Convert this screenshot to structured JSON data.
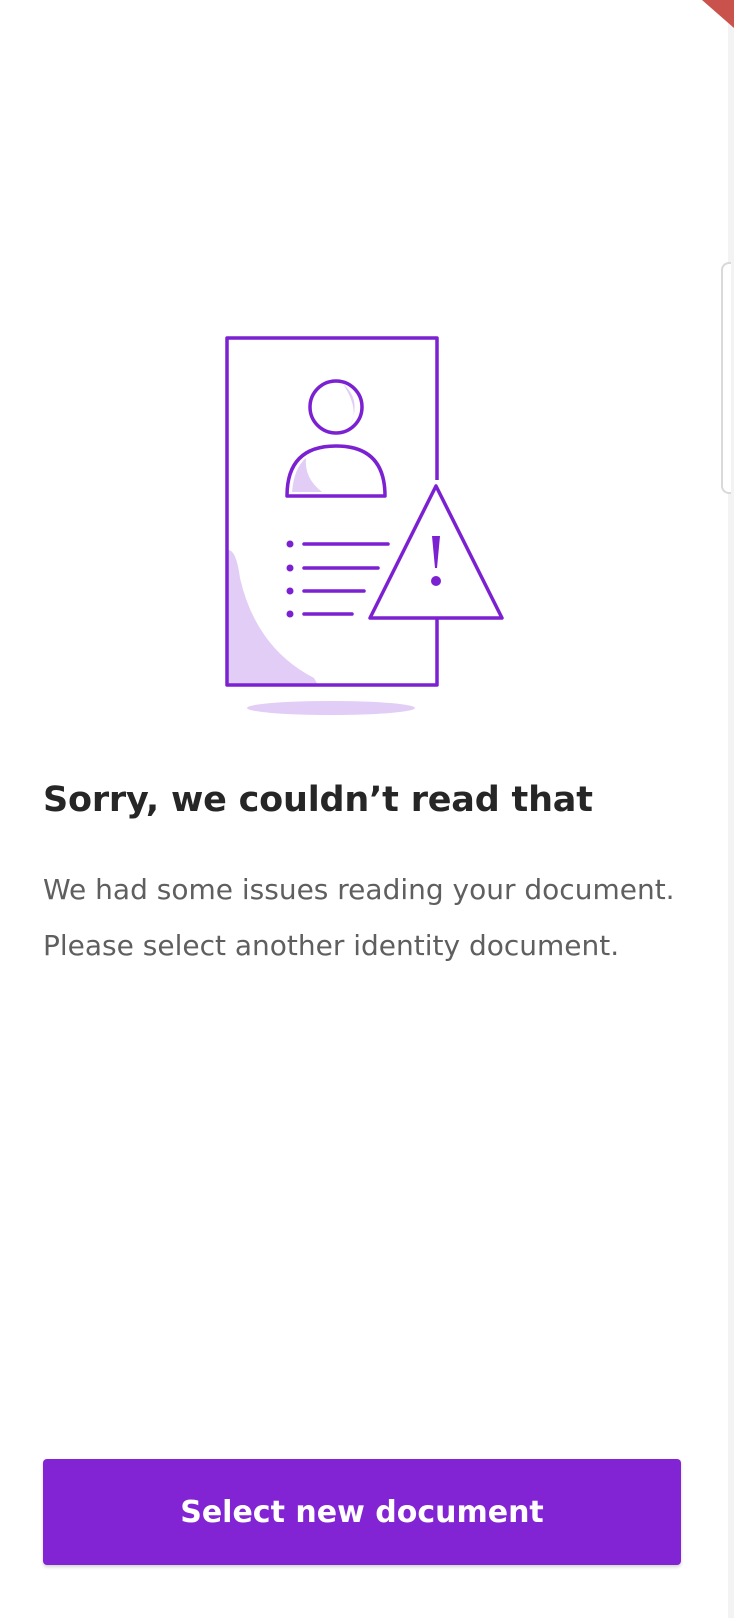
{
  "error_screen": {
    "title": "Sorry, we couldn’t read that",
    "message": "We had some issues reading your document. Please select another identity document.",
    "illustration_icon": "document-warning-icon"
  },
  "actions": {
    "primary_label": "Select new document"
  },
  "colors": {
    "accent": "#8324d4",
    "illustration_stroke": "#7b21d1",
    "illustration_fill": "#e2cdf6",
    "title": "#262626",
    "body": "#5f5f5f",
    "corner": "#c9524d"
  }
}
